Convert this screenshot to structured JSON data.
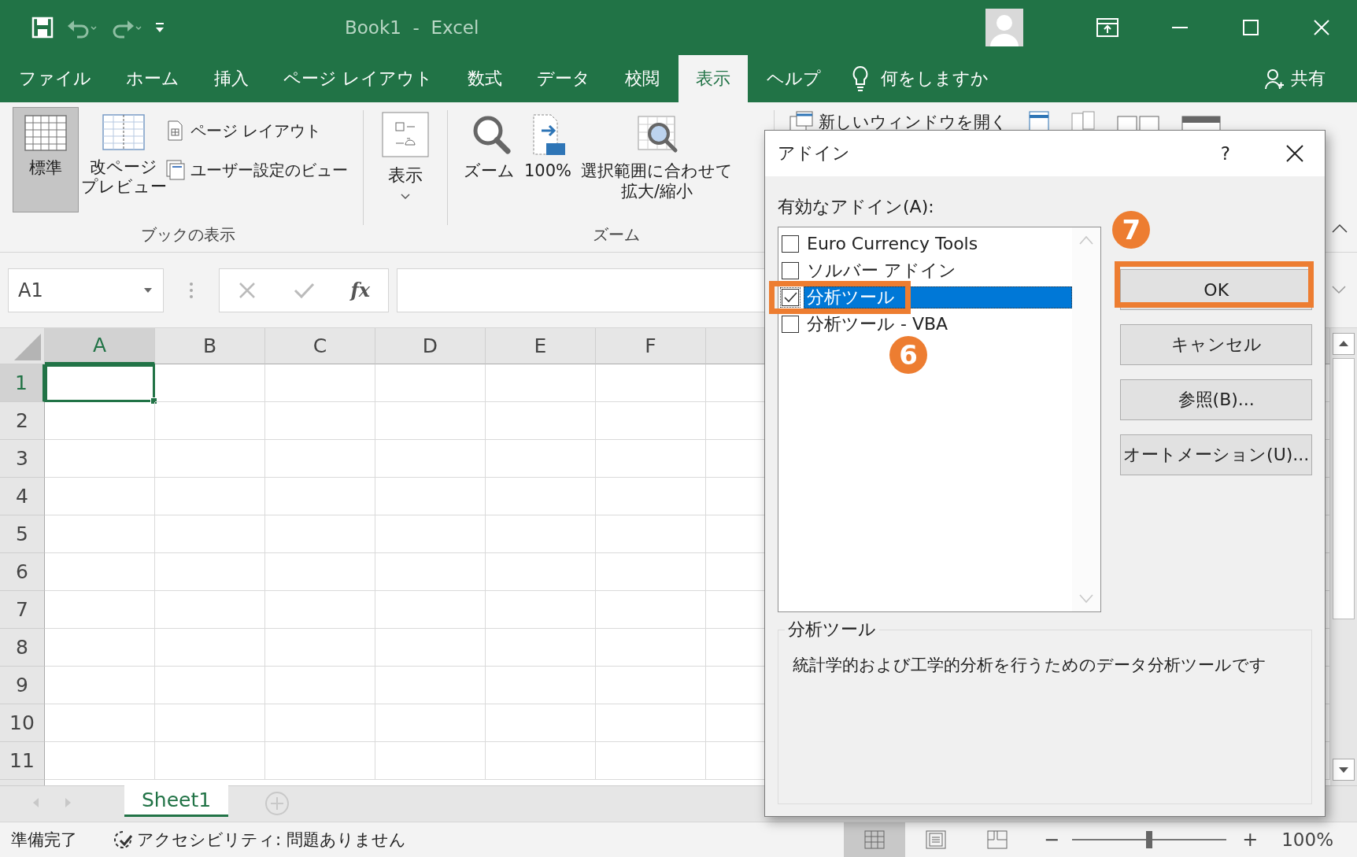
{
  "window": {
    "title": "Book1  -  Excel"
  },
  "menu_tabs": [
    {
      "label": "ファイル",
      "selected": false
    },
    {
      "label": "ホーム",
      "selected": false
    },
    {
      "label": "挿入",
      "selected": false
    },
    {
      "label": "ページ レイアウト",
      "selected": false
    },
    {
      "label": "数式",
      "selected": false
    },
    {
      "label": "データ",
      "selected": false
    },
    {
      "label": "校閲",
      "selected": false
    },
    {
      "label": "表示",
      "selected": true
    },
    {
      "label": "ヘルプ",
      "selected": false
    }
  ],
  "tell_me": "何をしますか",
  "share": "共有",
  "ribbon": {
    "book_views": {
      "label": "ブックの表示",
      "large": [
        {
          "label": [
            "標準"
          ],
          "selected": true
        },
        {
          "label": [
            "改ページ",
            "プレビュー"
          ],
          "selected": false
        }
      ],
      "small": [
        "ページ レイアウト",
        "ユーザー設定のビュー"
      ]
    },
    "show": {
      "label": "表示"
    },
    "zoom": {
      "label": "ズーム",
      "buttons": [
        [
          "ズーム"
        ],
        [
          "100%"
        ],
        [
          "選択範囲に合わせて",
          "拡大/縮小"
        ]
      ]
    },
    "window": {
      "new_window": "新しいウィンドウを開く"
    }
  },
  "formula_bar": {
    "name_box": "A1",
    "function_label": "fx"
  },
  "sheet": {
    "columns": [
      {
        "label": "A",
        "selected": true
      },
      {
        "label": "B",
        "selected": false
      },
      {
        "label": "C",
        "selected": false
      },
      {
        "label": "D",
        "selected": false
      },
      {
        "label": "E",
        "selected": false
      },
      {
        "label": "F",
        "selected": false
      }
    ],
    "rows": [
      {
        "label": "1",
        "selected": true
      },
      {
        "label": "2",
        "selected": false
      },
      {
        "label": "3",
        "selected": false
      },
      {
        "label": "4",
        "selected": false
      },
      {
        "label": "5",
        "selected": false
      },
      {
        "label": "6",
        "selected": false
      },
      {
        "label": "7",
        "selected": false
      },
      {
        "label": "8",
        "selected": false
      },
      {
        "label": "9",
        "selected": false
      },
      {
        "label": "10",
        "selected": false
      },
      {
        "label": "11",
        "selected": false
      }
    ]
  },
  "sheet_tabs": [
    {
      "label": "Sheet1",
      "selected": true
    }
  ],
  "status_bar": {
    "ready": "準備完了",
    "accessibility": "アクセシビリティ: 問題ありません",
    "views": [
      {
        "kind": "normal",
        "selected": true
      },
      {
        "kind": "page_layout",
        "selected": false
      },
      {
        "kind": "page_break",
        "selected": false
      }
    ],
    "zoom": {
      "minus": "−",
      "level": 0.5,
      "plus": "+",
      "reading": "100%"
    }
  },
  "dialog": {
    "title": "アドイン",
    "help": "?",
    "list_label": "有効なアドイン(A):",
    "addins": [
      {
        "label": "Euro Currency Tools",
        "checked": false,
        "selected": false
      },
      {
        "label": "ソルバー アドイン",
        "checked": false,
        "selected": false
      },
      {
        "label": "分析ツール",
        "checked": true,
        "selected": true,
        "step": "6"
      },
      {
        "label": "分析ツール - VBA",
        "checked": false,
        "selected": false
      }
    ],
    "buttons": [
      {
        "label": "OK",
        "step": "7"
      },
      {
        "label": "キャンセル"
      },
      {
        "label": "参照(B)..."
      },
      {
        "label": "オートメーション(U)..."
      }
    ],
    "description": {
      "title": "分析ツール",
      "text": "統計学的および工学的分析を行うためのデータ分析ツールです"
    }
  }
}
